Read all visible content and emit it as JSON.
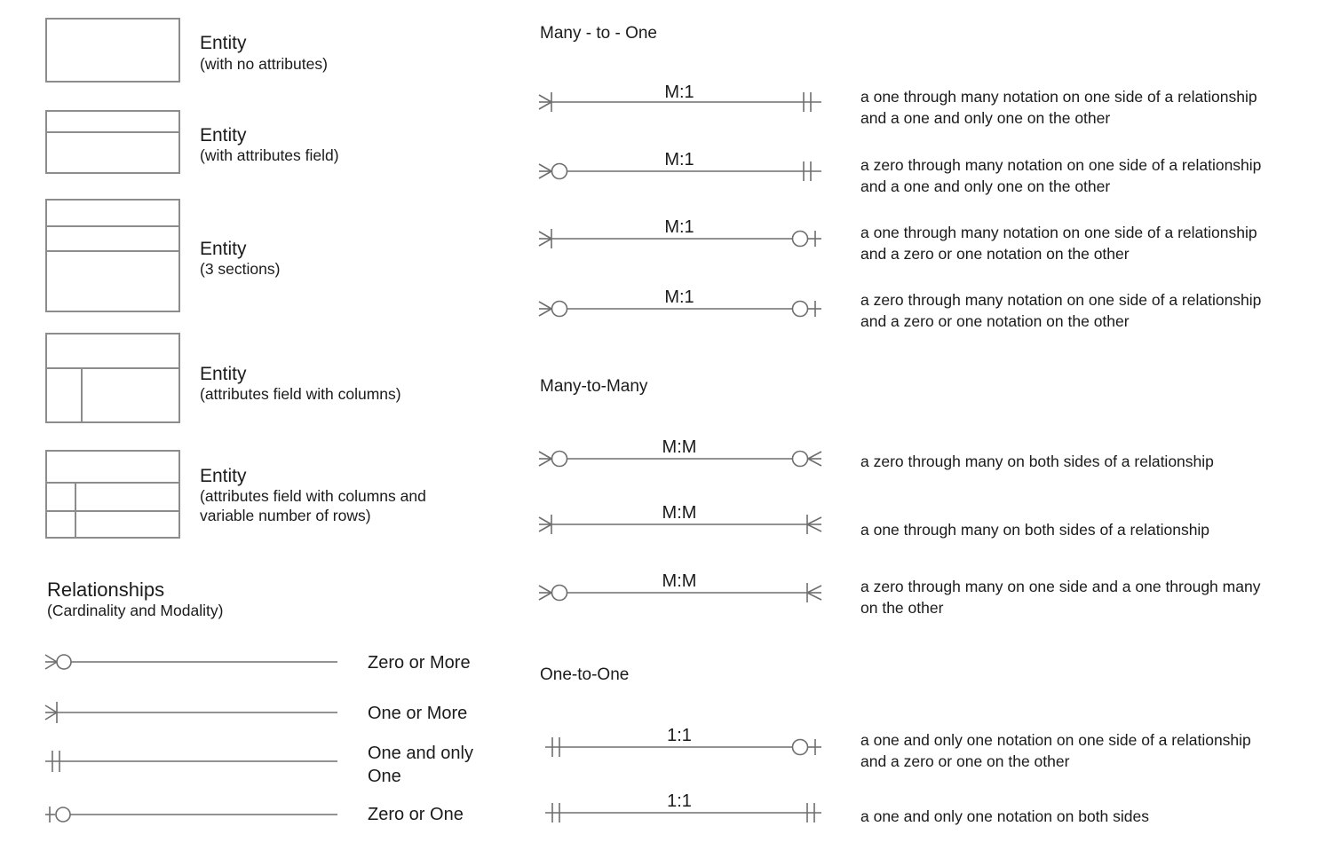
{
  "meta": {
    "stroke_color": "#6e6e6e",
    "box_border_color": "#8c8c8c",
    "text_color": "#1b1b1b",
    "background": "#ffffff"
  },
  "entities": [
    {
      "title": "Entity",
      "subtitle": "(with no attributes)"
    },
    {
      "title": "Entity",
      "subtitle": "(with attributes field)"
    },
    {
      "title": "Entity",
      "subtitle": "(3 sections)"
    },
    {
      "title": "Entity",
      "subtitle": "(attributes field with columns)"
    },
    {
      "title": "Entity",
      "subtitle": "(attributes field with columns and\nvariable number of rows)"
    }
  ],
  "relationships_header": {
    "title": "Relationships",
    "subtitle": "(Cardinality and Modality)"
  },
  "cardinality_legend": [
    {
      "label": "Zero or More",
      "left_end": "crowsfoot-circle"
    },
    {
      "label": "One or More",
      "left_end": "crowsfoot-tick"
    },
    {
      "label": "One and only\nOne",
      "left_end": "double-tick"
    },
    {
      "label": "Zero or One",
      "left_end": "tick-circle"
    }
  ],
  "sections": [
    {
      "heading": "Many - to - One",
      "rows": [
        {
          "cardinality": "M:1",
          "left_end": "crowsfoot-tick",
          "right_end": "double-tick",
          "description": "a one through many notation on one side of a relationship\nand a one and only one on the other"
        },
        {
          "cardinality": "M:1",
          "left_end": "crowsfoot-circle",
          "right_end": "double-tick",
          "description": "a zero through many notation on one side of a relationship\nand a one and only one on the other"
        },
        {
          "cardinality": "M:1",
          "left_end": "crowsfoot-tick",
          "right_end": "circle-tick",
          "description": "a one through many notation on one side of a relationship\nand a zero or one notation on the other"
        },
        {
          "cardinality": "M:1",
          "left_end": "crowsfoot-circle",
          "right_end": "circle-tick",
          "description": "a zero through many notation on one side of a relationship\nand a zero or one notation on the other"
        }
      ]
    },
    {
      "heading": "Many-to-Many",
      "rows": [
        {
          "cardinality": "M:M",
          "left_end": "crowsfoot-circle",
          "right_end": "circle-crowsfoot",
          "description": "a zero through many on both sides of a relationship"
        },
        {
          "cardinality": "M:M",
          "left_end": "crowsfoot-tick",
          "right_end": "tick-crowsfoot",
          "description": "a one through many on both sides of a relationship"
        },
        {
          "cardinality": "M:M",
          "left_end": "crowsfoot-circle",
          "right_end": "tick-crowsfoot",
          "description": "a zero through many on one side and a one through many\non the other"
        }
      ]
    },
    {
      "heading": "One-to-One",
      "rows": [
        {
          "cardinality": "1:1",
          "left_end": "double-tick",
          "right_end": "circle-tick",
          "description": "a one and only one notation on one side of a relationship\nand a zero or one on the other"
        },
        {
          "cardinality": "1:1",
          "left_end": "double-tick",
          "right_end": "double-tick",
          "description": "a one and only one notation on both sides"
        }
      ]
    }
  ]
}
